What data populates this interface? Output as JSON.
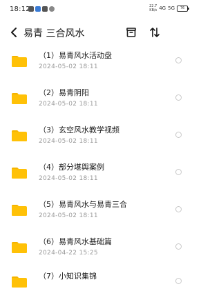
{
  "status_bar": {
    "time": "18:12",
    "speed_value": "22.7",
    "speed_unit": "KB/s",
    "network": "4G",
    "signal": "5G",
    "battery": "76"
  },
  "header": {
    "title": "易青 三合风水",
    "back_icon": "chevron-left-icon",
    "archive_icon": "archive-box-icon",
    "sort_icon": "sort-arrows-icon"
  },
  "colors": {
    "folder": "#FFC107",
    "folder_tab": "#F5B400",
    "date_text": "#9a9a9a"
  },
  "files": [
    {
      "name": "（1）易青风水活动盘",
      "date": "2024-05-02  18:11"
    },
    {
      "name": "（2）易青阴阳",
      "date": "2024-05-02  18:11"
    },
    {
      "name": "（3）玄空风水教学视频",
      "date": "2024-05-02  18:11"
    },
    {
      "name": "（4）部分堪舆案例",
      "date": "2024-05-02  18:11"
    },
    {
      "name": "（5）易青风水与易青三合",
      "date": "2024-05-02  18:11"
    },
    {
      "name": "（6）易青风水基础篇",
      "date": "2024-04-22  15:25"
    },
    {
      "name": "（7）小知识集锦",
      "date": ""
    }
  ]
}
